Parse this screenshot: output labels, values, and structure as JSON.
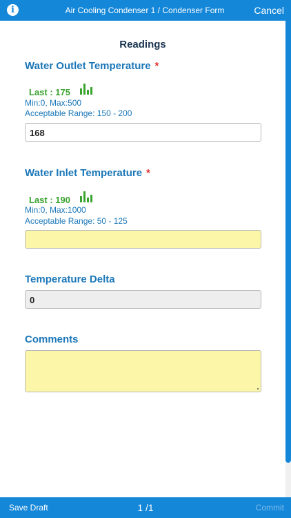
{
  "header": {
    "info_icon": "info-icon",
    "info_glyph": "i",
    "title": "Air Cooling Condenser 1 / Condenser Form",
    "cancel_label": "Cancel"
  },
  "section": {
    "title": "Readings"
  },
  "fields": {
    "water_outlet": {
      "label": "Water Outlet Temperature",
      "required_mark": "*",
      "last": "Last : 175",
      "minmax": "Min:0, Max:500",
      "range": "Acceptable Range: 150 - 200",
      "value": "168"
    },
    "water_inlet": {
      "label": "Water Inlet Temperature",
      "required_mark": "*",
      "last": "Last : 190",
      "minmax": "Min:0, Max:1000",
      "range": "Acceptable Range: 50 - 125",
      "value": ""
    },
    "temperature_delta": {
      "label": "Temperature Delta",
      "value": "0"
    },
    "comments": {
      "label": "Comments",
      "value": ""
    }
  },
  "footer": {
    "save_draft_label": "Save Draft",
    "page_indicator": "1 /1",
    "commit_label": "Commit"
  },
  "colors": {
    "accent": "#1487d9",
    "label_blue": "#1b77b8",
    "last_green": "#3aa22f",
    "required_red": "#e03030",
    "input_yellow": "#fcf6a9"
  }
}
